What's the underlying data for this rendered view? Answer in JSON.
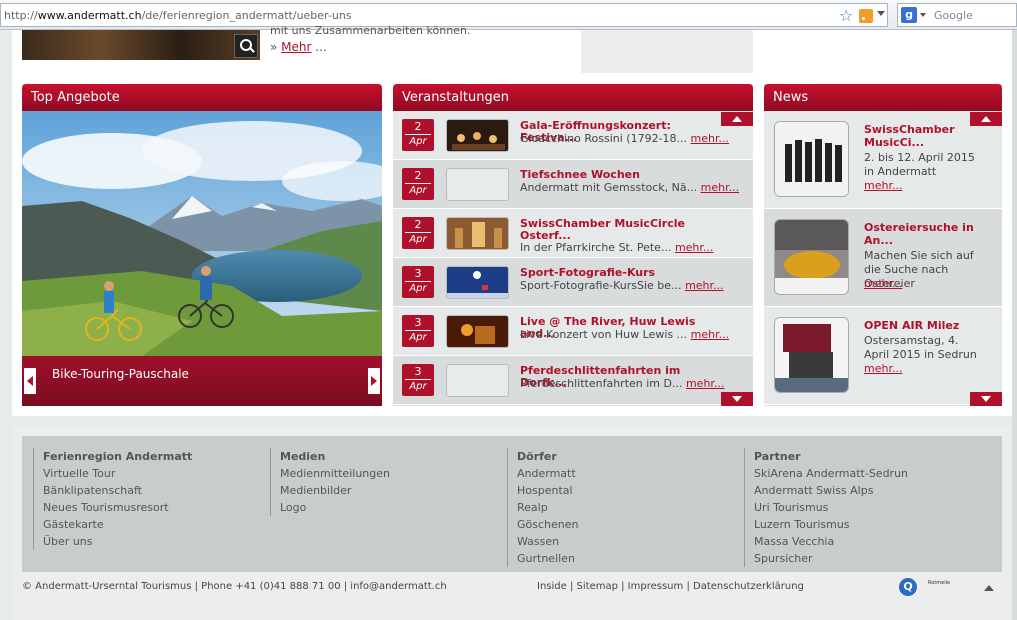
{
  "browser": {
    "url_prefix": "http://",
    "url_domain": "www.andermatt.ch",
    "url_path": "/de/ferienregion_andermatt/ueber-uns",
    "search_engine": "Google"
  },
  "top": {
    "cut_text": "mit uns Zusammenarbeiten können.",
    "more_prefix": "»",
    "more_label": "Mehr",
    "more_suffix": "..."
  },
  "top_offers": {
    "title": "Top Angebote",
    "caption": "Bike-Touring-Pauschale"
  },
  "events": {
    "title": "Veranstaltungen",
    "items": [
      {
        "day": "2",
        "month": "Apr",
        "title": "Gala-Eröffnungskonzert: Festiva...",
        "desc": "Gioacchino Rossini (1792-18...",
        "more": "mehr..."
      },
      {
        "day": "2",
        "month": "Apr",
        "title": "Tiefschnee Wochen",
        "desc": "Andermatt mit Gemsstock, Nä...",
        "more": "mehr..."
      },
      {
        "day": "2",
        "month": "Apr",
        "title": "SwissChamber MusicCircle Osterf...",
        "desc": "In der Pfarrkirche St. Pete...",
        "more": "mehr..."
      },
      {
        "day": "3",
        "month": "Apr",
        "title": "Sport-Fotografie-Kurs",
        "desc": "Sport-Fotografie-KursSie be...",
        "more": "mehr..."
      },
      {
        "day": "3",
        "month": "Apr",
        "title": "Live @ The River, Huw Lewis and...",
        "desc": "Live Konzert von Huw Lewis ...",
        "more": "mehr..."
      },
      {
        "day": "3",
        "month": "Apr",
        "title": "Pferdeschlittenfahrten im Dorfk...",
        "desc": "Pferdeschlittenfahrten im D...",
        "more": "mehr..."
      }
    ]
  },
  "news": {
    "title": "News",
    "items": [
      {
        "title": "SwissChamber MusicCi...",
        "desc": "2. bis 12. April 2015 in Andermatt",
        "more": "mehr..."
      },
      {
        "title": "Ostereiersuche in An...",
        "desc": "Machen Sie sich auf die Suche nach Ostereier",
        "more": "mehr..."
      },
      {
        "title": "OPEN AIR Milez",
        "desc": "Ostersamstag, 4. April 2015 in Sedrun",
        "more": "mehr..."
      }
    ]
  },
  "footer": {
    "columns": [
      {
        "heading": "Ferienregion Andermatt",
        "links": [
          "Virtuelle Tour",
          "Bänklipatenschaft",
          "Neues Tourismusresort",
          "Gästekarte",
          "Über uns"
        ]
      },
      {
        "heading": "Medien",
        "links": [
          "Medienmitteilungen",
          "Medienbilder",
          "Logo"
        ]
      },
      {
        "heading": "Dörfer",
        "links": [
          "Andermatt",
          "Hospental",
          "Realp",
          "Göschenen",
          "Wassen",
          "Gurtnellen"
        ]
      },
      {
        "heading": "Partner",
        "links": [
          "SkiArena Andermatt-Sedrun",
          "Andermatt Swiss Alps",
          "Uri Tourismus",
          "Luzern Tourismus",
          "Massa Vecchia",
          "Spursicher"
        ]
      }
    ],
    "copyright": "© Andermatt-Urserntal Tourismus | Phone +41 (0)41 888 71 00 | info@andermatt.ch",
    "bottom_links": [
      "Inside",
      "Sitemap",
      "Impressum",
      "Datenschutzerklärung"
    ],
    "logo1": "Q",
    "logo2": "Rotmeile"
  }
}
